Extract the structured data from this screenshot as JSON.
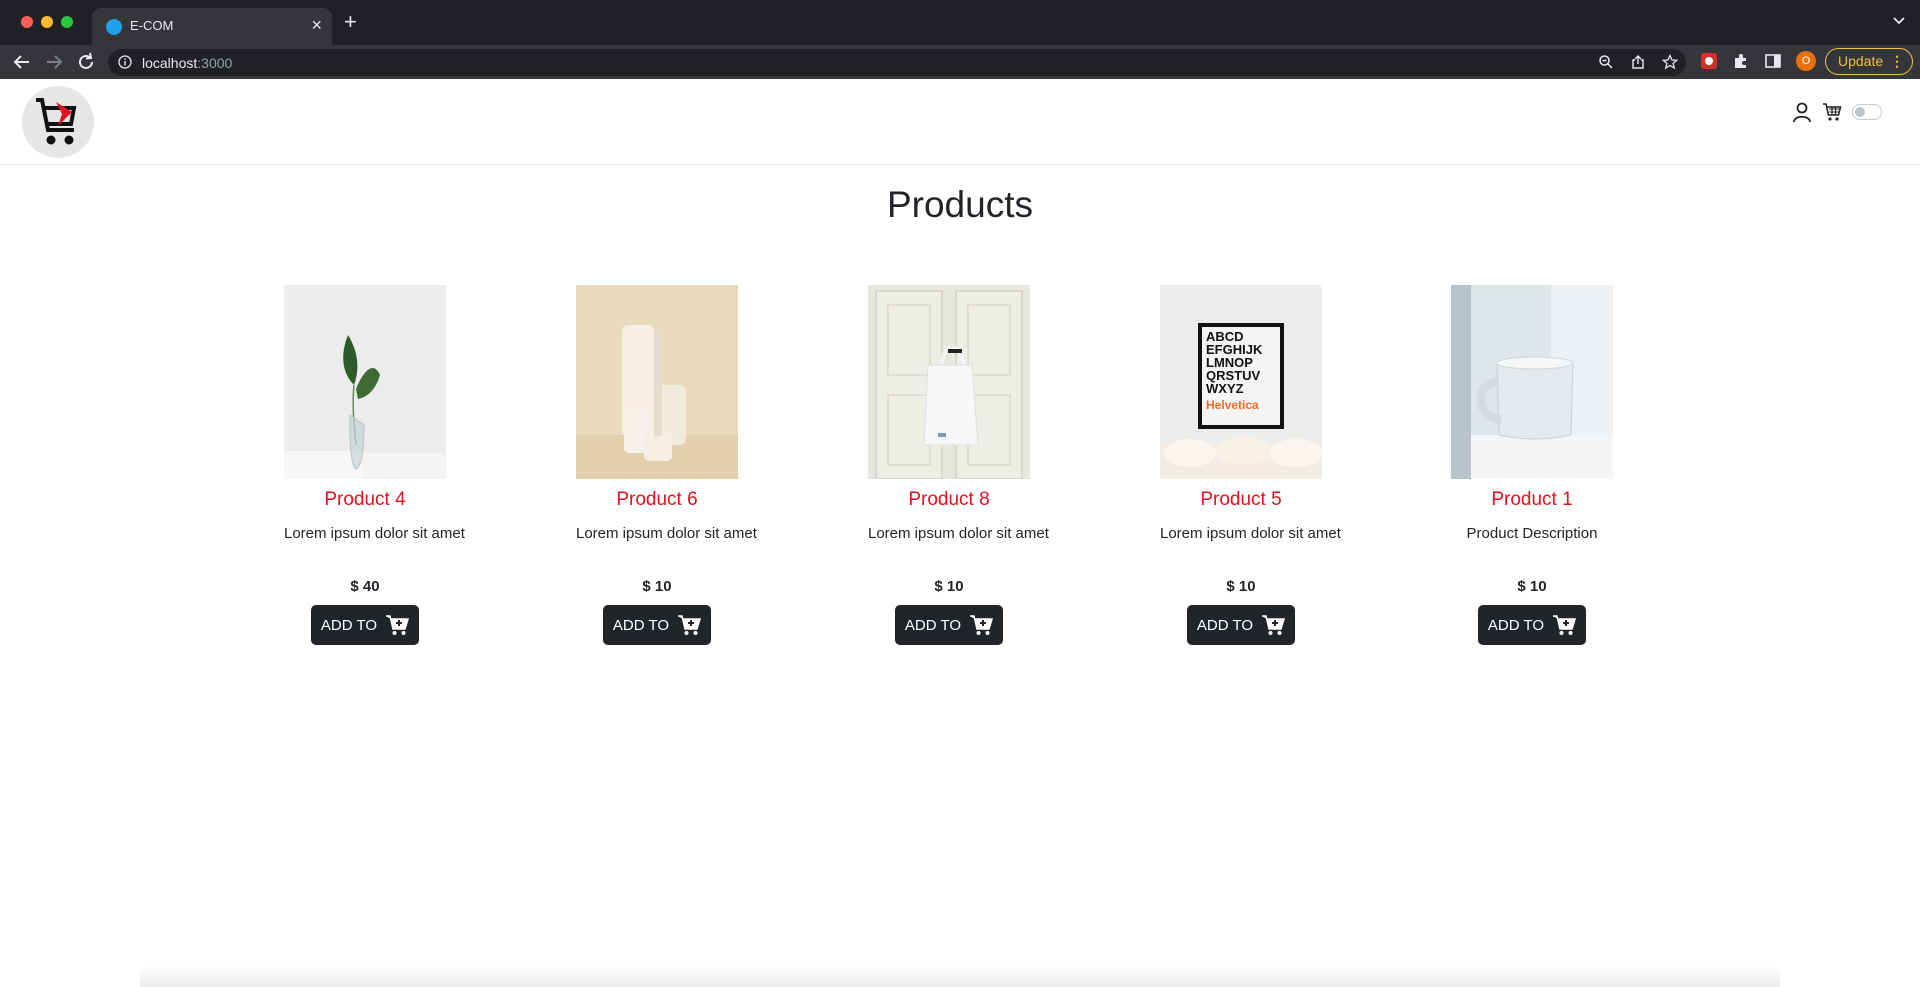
{
  "browser": {
    "tab_title": "E-COM",
    "url_host": "localhost",
    "url_port": ":3000",
    "update_label": "Update",
    "profile_initial": "O"
  },
  "header": {
    "icons": [
      "user-icon",
      "cart-icon",
      "theme-toggle"
    ]
  },
  "page": {
    "title": "Products"
  },
  "products": [
    {
      "name": "Product 4",
      "description": "Lorem ipsum dolor sit amet",
      "price": "$ 40",
      "button": "ADD TO",
      "image": "plant-in-vase"
    },
    {
      "name": "Product 6",
      "description": "Lorem ipsum dolor sit amet",
      "price": "$ 10",
      "button": "ADD TO",
      "image": "white-candles"
    },
    {
      "name": "Product 8",
      "description": "Lorem ipsum dolor sit amet",
      "price": "$ 10",
      "button": "ADD TO",
      "image": "tote-bag"
    },
    {
      "name": "Product 5",
      "description": "Lorem ipsum dolor sit amet",
      "price": "$ 10",
      "button": "ADD TO",
      "image": "helvetica-poster"
    },
    {
      "name": "Product 1",
      "description": "Product Description",
      "price": "$ 10",
      "button": "ADD TO",
      "image": "white-mug"
    }
  ],
  "poster_text": [
    "ABCD",
    "EFGHIJK",
    "LMNOP",
    "QRSTUV",
    "WXYZ",
    "Helvetica"
  ],
  "colors": {
    "product_name": "#e3101f",
    "button_bg": "#212529",
    "update_accent": "#f4c04c"
  }
}
